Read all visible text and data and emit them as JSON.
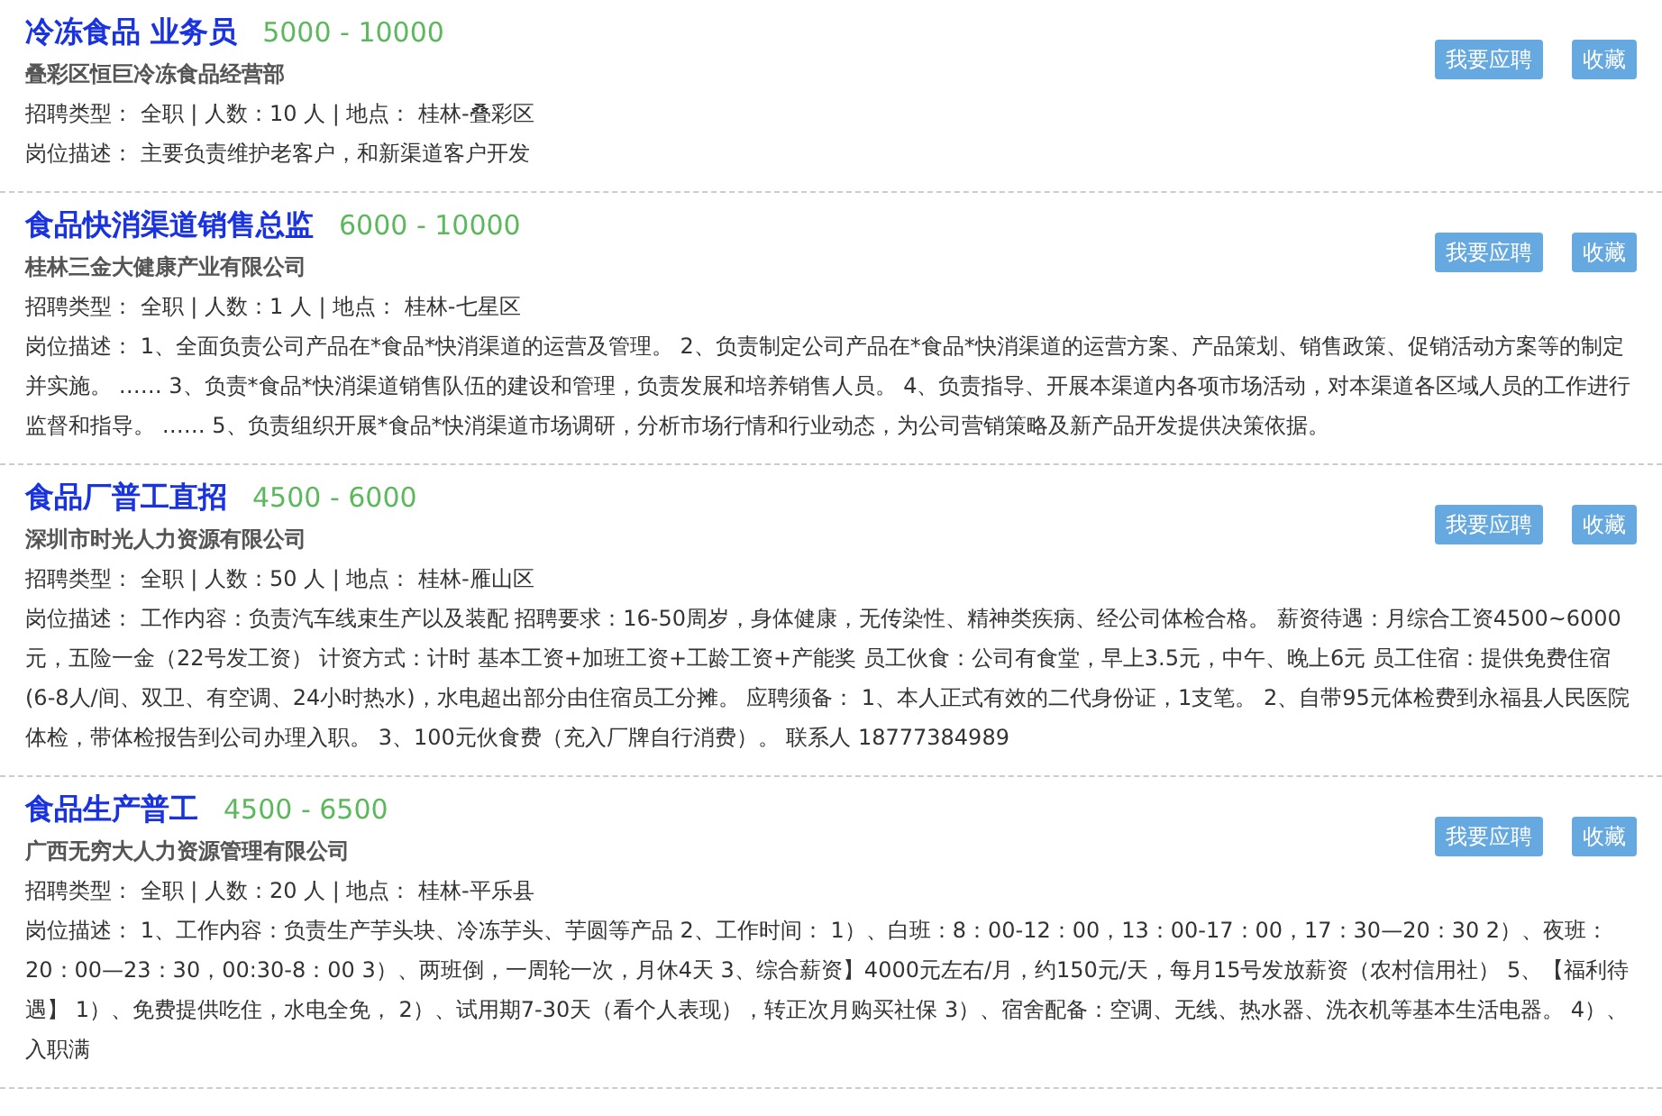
{
  "jobs": [
    {
      "title": "冷冻食品 业务员",
      "salary": "5000 - 10000",
      "company": "叠彩区恒巨冷冻食品经营部",
      "meta": "招聘类型： 全职 | 人数：10 人 | 地点： 桂林-叠彩区",
      "description": "岗位描述： 主要负责维护老客户，和新渠道客户开发",
      "apply_button": "我要应聘",
      "save_button": "收藏"
    },
    {
      "title": "食品快消渠道销售总监",
      "salary": "6000 - 10000",
      "company": "桂林三金大健康产业有限公司",
      "meta": "招聘类型： 全职 | 人数：1 人 | 地点： 桂林-七星区",
      "description": "岗位描述： 1、全面负责公司产品在*食品*快消渠道的运营及管理。 2、负责制定公司产品在*食品*快消渠道的运营方案、产品策划、销售政策、促销活动方案等的制定并实施。 …… 3、负责*食品*快消渠道销售队伍的建设和管理，负责发展和培养销售人员。 4、负责指导、开展本渠道内各项市场活动，对本渠道各区域人员的工作进行监督和指导。 …… 5、负责组织开展*食品*快消渠道市场调研，分析市场行情和行业动态，为公司营销策略及新产品开发提供决策依据。",
      "apply_button": "我要应聘",
      "save_button": "收藏"
    },
    {
      "title": "食品厂普工直招",
      "salary": "4500 - 6000",
      "company": "深圳市时光人力资源有限公司",
      "meta": "招聘类型： 全职 | 人数：50 人 | 地点： 桂林-雁山区",
      "description": "岗位描述： 工作内容：负责汽车线束生产以及装配 招聘要求：16-50周岁，身体健康，无传染性、精神类疾病、经公司体检合格。 薪资待遇：月综合工资4500~6000元，五险一金（22号发工资） 计资方式：计时 基本工资+加班工资+工龄工资+产能奖 员工伙食：公司有食堂，早上3.5元，中午、晚上6元 员工住宿：提供免费住宿(6-8人/间、双卫、有空调、24小时热水)，水电超出部分由住宿员工分摊。 应聘须备： 1、本人正式有效的二代身份证，1支笔。 2、自带95元体检费到永福县人民医院体检，带体检报告到公司办理入职。 3、100元伙食费（充入厂牌自行消费）。 联系人 18777384989",
      "apply_button": "我要应聘",
      "save_button": "收藏"
    },
    {
      "title": "食品生产普工",
      "salary": "4500 - 6500",
      "company": "广西无穷大人力资源管理有限公司",
      "meta": "招聘类型： 全职 | 人数：20 人 | 地点： 桂林-平乐县",
      "description": "岗位描述： 1、工作内容：负责生产芋头块、冷冻芋头、芋圆等产品 2、工作时间： 1）、白班：8：00-12：00，13：00-17：00，17：30—20：30 2）、夜班：20：00—23：30，00:30-8：00 3）、两班倒，一周轮一次，月休4天 3、综合薪资】4000元左右/月，约150元/天，每月15号发放薪资（农村信用社） 5、【福利待遇】 1）、免费提供吃住，水电全免， 2）、试用期7-30天（看个人表现），转正次月购买社保 3）、宿舍配备：空调、无线、热水器、洗衣机等基本生活电器。 4）、入职满",
      "apply_button": "我要应聘",
      "save_button": "收藏"
    }
  ]
}
